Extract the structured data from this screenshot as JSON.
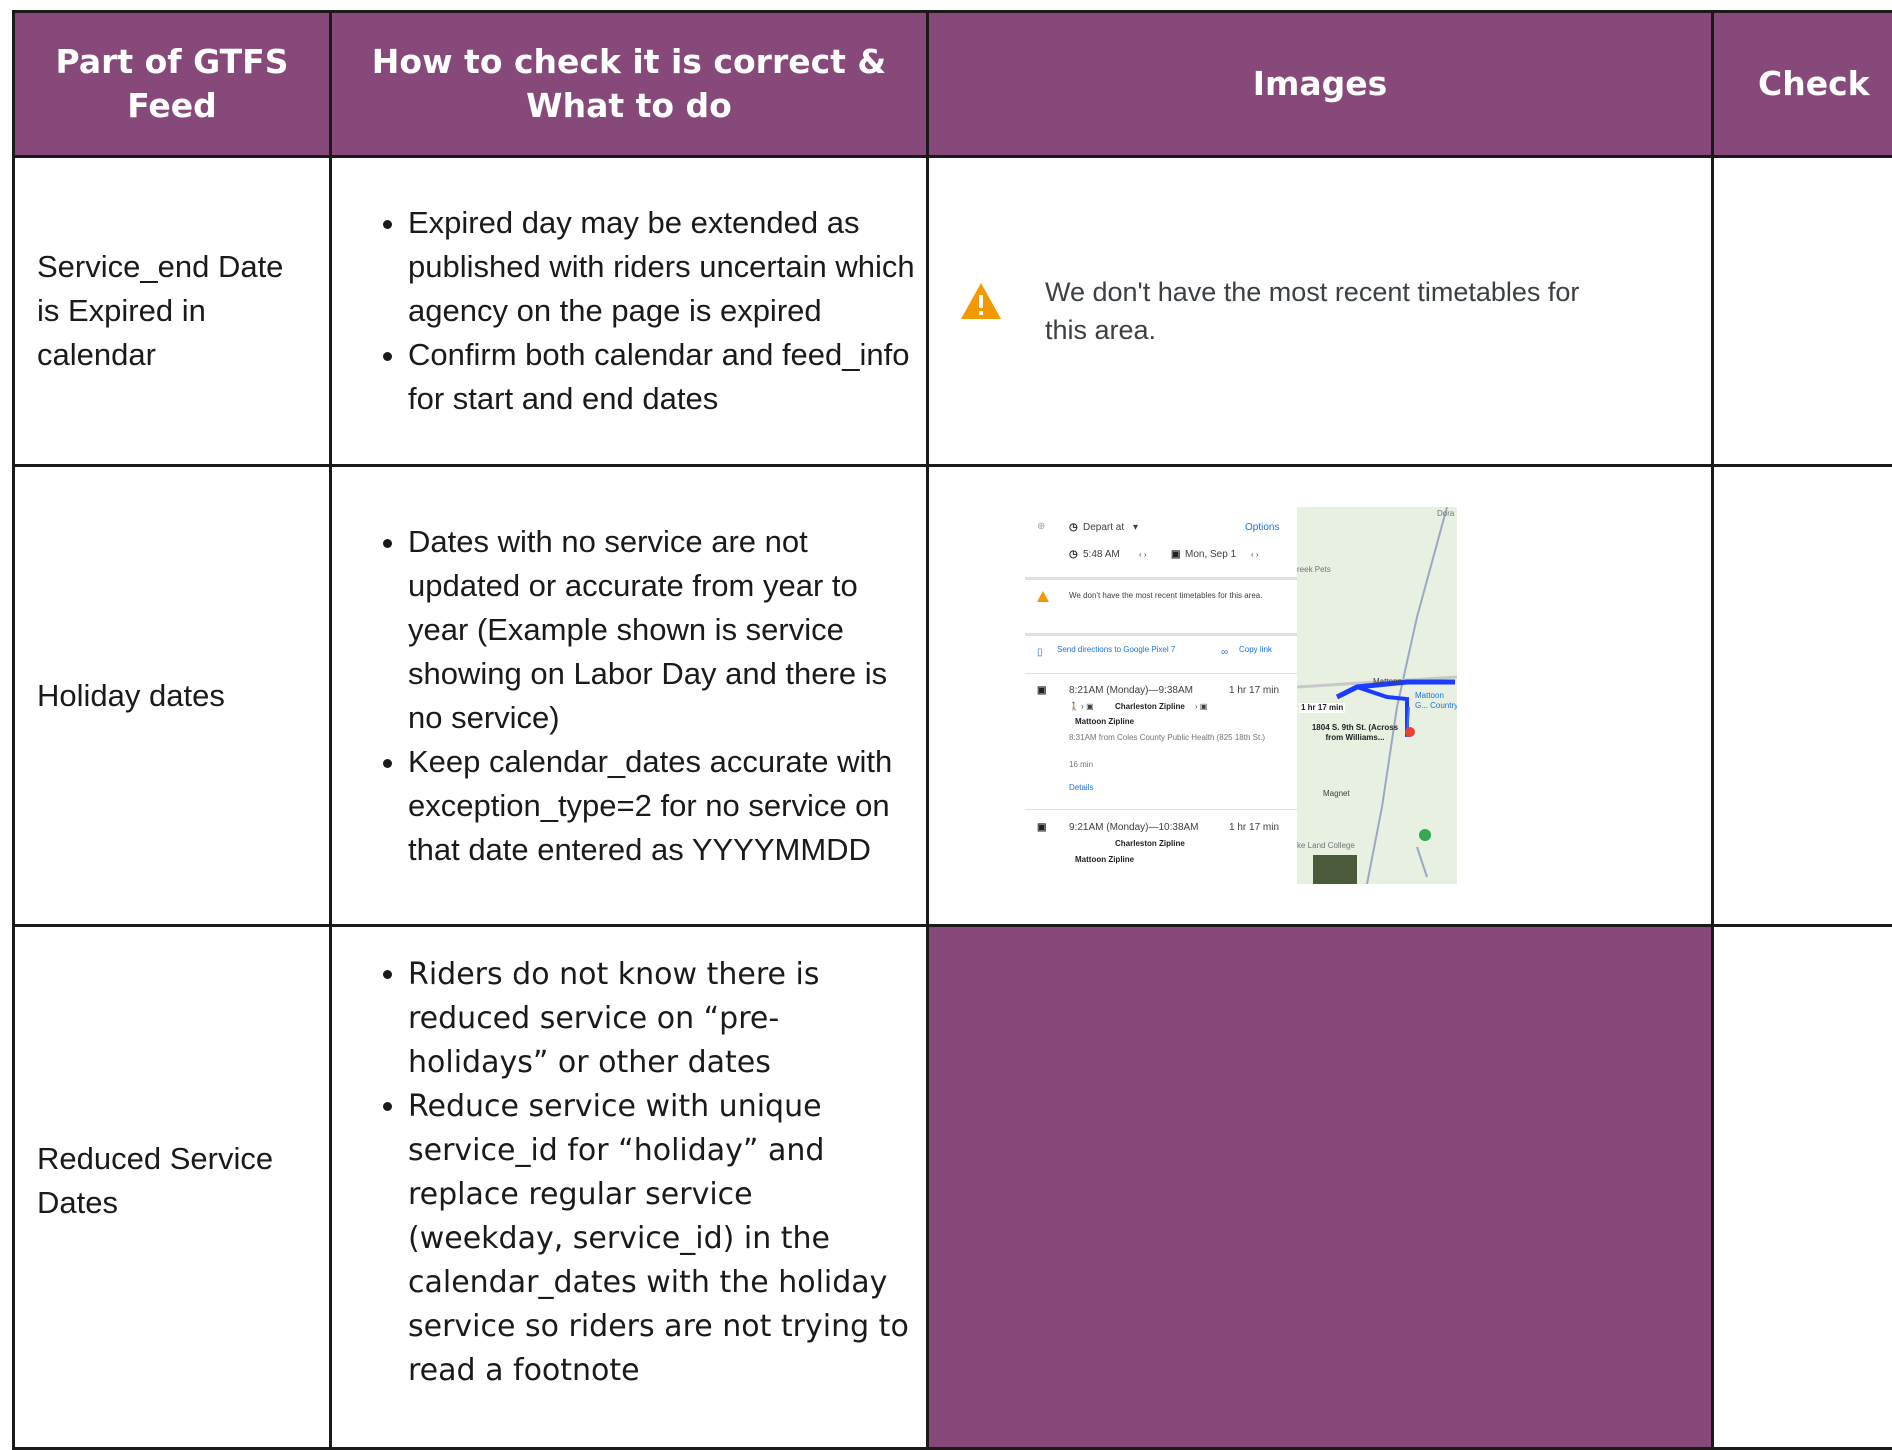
{
  "header": {
    "part": "Part of GTFS Feed",
    "how": "How to check it is correct & What to do",
    "images": "Images",
    "check": "Check"
  },
  "rows": [
    {
      "part": "Service_end Date is Expired in calendar",
      "how": [
        "Expired day may be extended as published with riders uncertain which agency on the page is expired",
        "Confirm both calendar and feed_info for start and end dates"
      ],
      "image_text": "We don't have the most recent timetables for this area.",
      "image_icon": "warning-icon"
    },
    {
      "part": "Holiday dates",
      "how": [
        "Dates with no service are not updated or accurate from year to year (Example shown is service showing on Labor Day and there is no service)",
        "Keep calendar_dates accurate with exception_type=2 for no service on that date entered as YYYYMMDD"
      ],
      "screenshot": {
        "depart": "Depart at",
        "options": "Options",
        "time": "5:48 AM",
        "date": "Mon, Sep 1",
        "warning": "We don't have the most recent timetables for this area.",
        "send": "Send directions to Google Pixel 7",
        "copy": "Copy link",
        "trip1_time": "8:21AM (Monday)—9:38AM",
        "trip1_dur": "1 hr 17 min",
        "line1": "Charleston Zipline",
        "line2": "Mattoon Zipline",
        "trip1_from": "8:31AM from Coles County Public Health (825 18th St.)",
        "walk": "16 min",
        "details": "Details",
        "trip2_time": "9:21AM (Monday)—10:38AM",
        "trip2_dur": "1 hr 17 min",
        "map_dur": "1 hr 17 min",
        "map_addr": "1804 S. 9th St. (Across from Williams...",
        "map_magnet": "Magnet",
        "map_mattoon": "Mattoon",
        "map_country": "Mattoon G... Country",
        "map_creek": "reek Pets",
        "map_college": "ke Land College",
        "map_dora": "Dora"
      }
    },
    {
      "part": "Reduced Service Dates",
      "how": [
        "Riders do not know there is reduced service on “pre-holidays” or other dates",
        "Reduce service with unique service_id for “holiday” and replace regular service (weekday, service_id) in the calendar_dates with the holiday service so riders are not trying to read a footnote"
      ]
    }
  ],
  "colors": {
    "header_bg": "#86497a",
    "header_text": "#ffffff",
    "warning": "#f29900",
    "route": "#1a3cff"
  }
}
